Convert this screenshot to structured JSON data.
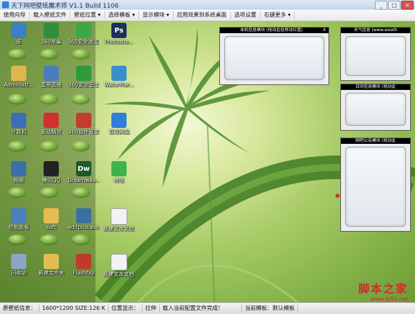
{
  "window": {
    "title": "天下网吧壁纸魔术师 V1.1 Build 1106",
    "minimize": "_",
    "maximize": "□",
    "close": "×"
  },
  "menu": [
    "使用向导",
    "载入壁纸文件",
    "壁纸位置 ▾",
    "选择模板 ▾",
    "显示模块 ▾",
    "应用效果到系统桌面",
    "选项设置",
    "右键更多 ▾"
  ],
  "desktop_icons": [
    {
      "label": "库",
      "icon": "library-icon",
      "color": "#3a7fc9"
    },
    {
      "label": "360杀毒",
      "icon": "shield-icon",
      "color": "#2f8f3a"
    },
    {
      "label": "360安全浏览器",
      "icon": "browser-icon",
      "color": "#3aa84a"
    },
    {
      "label": "Photosho...",
      "icon": "photoshop-icon",
      "color": "#1a2f5a"
    },
    {
      "label": "Administr...",
      "icon": "user-folder-icon",
      "color": "#e0b64c"
    },
    {
      "label": "宽带连接",
      "icon": "network-icon",
      "color": "#4a7dc0"
    },
    {
      "label": "360安全卫士",
      "icon": "guard-icon",
      "color": "#2e9b3b"
    },
    {
      "label": "WaterMar...",
      "icon": "watermark-icon",
      "color": "#3b8fc9"
    },
    {
      "label": "计算机",
      "icon": "computer-icon",
      "color": "#3b6fb5"
    },
    {
      "label": "驱动精灵",
      "icon": "driver-icon",
      "color": "#d03030"
    },
    {
      "label": "360软件管家",
      "icon": "software-manager-icon",
      "color": "#c33c2e"
    },
    {
      "label": "百度网盘",
      "icon": "cloud-icon",
      "color": "#2f7fd8"
    },
    {
      "label": "网络",
      "icon": "network-places-icon",
      "color": "#3d6fb0"
    },
    {
      "label": "腾讯QQ",
      "icon": "qq-icon",
      "color": "#222222"
    },
    {
      "label": "Dreamwea...",
      "icon": "dreamweaver-icon",
      "color": "#1c5a2a"
    },
    {
      "label": "微信",
      "icon": "wechat-icon",
      "color": "#3bb44a"
    },
    {
      "label": "控制面板",
      "icon": "control-panel-icon",
      "color": "#4a7fc0"
    },
    {
      "label": "soft",
      "icon": "folder-icon",
      "color": "#e3bd52"
    },
    {
      "label": "editplus.exe",
      "icon": "editplus-icon",
      "color": "#3b6fa0"
    },
    {
      "label": "新建文本文档 (2).txt",
      "icon": "text-file-icon",
      "color": "#f2f2f2"
    },
    {
      "label": "回收站",
      "icon": "recycle-bin-icon",
      "color": "#8aa6c8"
    },
    {
      "label": "新建文件夹",
      "icon": "folder-icon",
      "color": "#e3bd52"
    },
    {
      "label": "Flashfxp",
      "icon": "flashfxp-icon",
      "color": "#c0392b"
    },
    {
      "label": "新建文本文档 (3).txt",
      "icon": "text-file-icon",
      "color": "#f2f2f2"
    }
  ],
  "icon_glyphs": {
    "photoshop": "Ps",
    "dreamweaver": "Dw"
  },
  "panels": {
    "local_info": {
      "title": "本机信息模块 (拖动此处移动位置)",
      "close": "X"
    },
    "weather": {
      "title": "天气信息 (www.weath"
    },
    "daily_quote": {
      "title": "日间信息模块 (拖动此"
    },
    "cafe_notice": {
      "title": "网吧公告模块 (拖动此"
    }
  },
  "statusbar": {
    "wallpaper_info_label": "原壁纸信息：",
    "wallpaper_info_value": "1600*1200 SIZE:126 K",
    "position_label": "位置显示：",
    "position_value": "拉伸",
    "load_status": "载入当前配置文件完成！",
    "template_label": "当前模板：默认模板"
  },
  "watermark": {
    "text": "脚本之家",
    "url": "www.jb51.net"
  },
  "colors": {
    "accent_red": "#d6282a",
    "panel_title_bg": "#000000"
  }
}
